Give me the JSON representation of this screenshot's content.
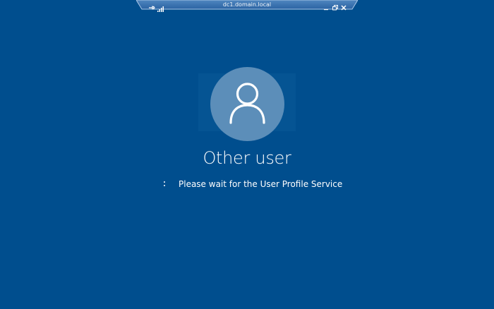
{
  "connection_bar": {
    "host": "dc1.domain.local",
    "pin_icon": "pin-icon",
    "signal_icon": "connection-quality-icon",
    "minimize_icon": "minimize-icon",
    "restore_icon": "restore-icon",
    "close_icon": "close-icon"
  },
  "login": {
    "avatar_icon": "user-icon",
    "user_name": "Other user",
    "spinner_icon": "spinner-icon",
    "status_message": "Please wait for the User Profile Service"
  },
  "colors": {
    "background": "#004e8e",
    "avatar": "#5c8eb9",
    "text": "#ffffff"
  }
}
